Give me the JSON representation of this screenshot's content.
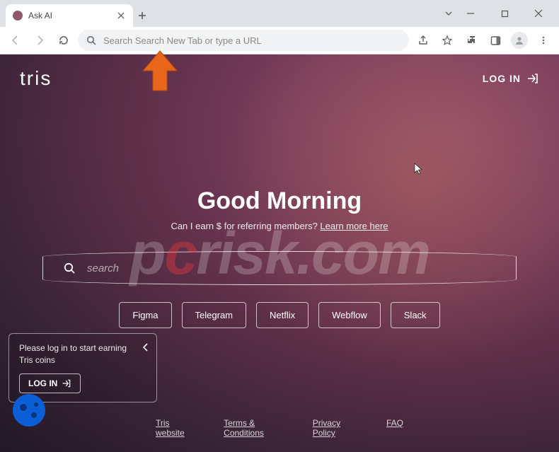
{
  "browser": {
    "tab_title": "Ask AI",
    "omnibox_placeholder": "Search Search New Tab or type a URL"
  },
  "page": {
    "logo_text": "tris",
    "login_top": "LOG IN",
    "greeting": "Good Morning",
    "sub_prefix": "Can I earn $ for referring members? ",
    "sub_link": "Learn more here",
    "search_placeholder": "search",
    "chips": [
      "Figma",
      "Telegram",
      "Netflix",
      "Webflow",
      "Slack"
    ],
    "login_card": {
      "text": "Please log in to start earning Tris coins",
      "button": "LOG IN"
    },
    "footer": [
      "Tris website",
      "Terms & Conditions",
      "Privacy Policy",
      "FAQ"
    ]
  },
  "watermark": {
    "p": "p",
    "c": "c",
    "rest": "risk.com"
  }
}
